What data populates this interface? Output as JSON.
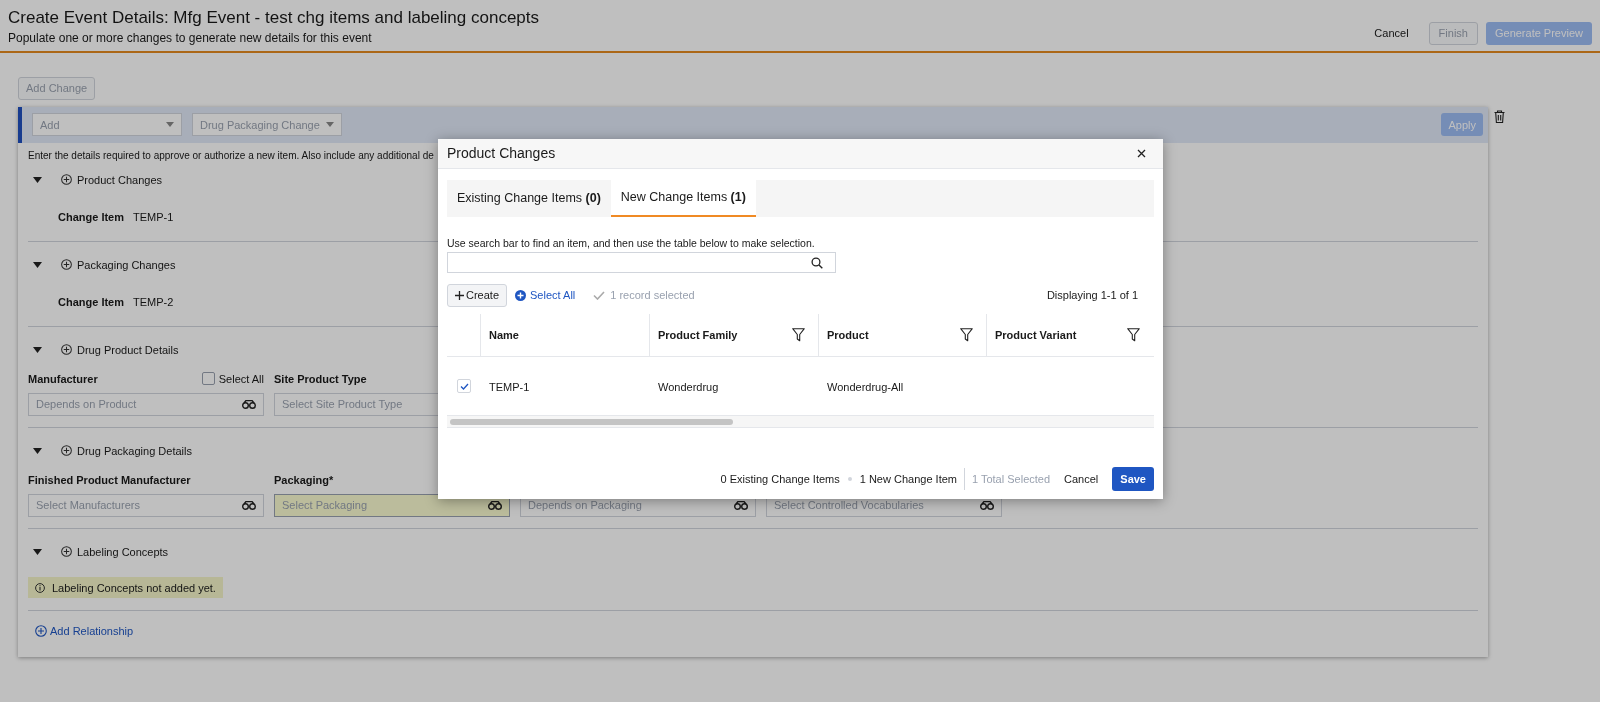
{
  "page": {
    "title": "Create Event Details: Mfg Event - test chg items and labeling concepts",
    "subtitle": "Populate one or more changes to generate new details for this event"
  },
  "header_actions": [
    {
      "label": "Cancel",
      "kind": "link",
      "disabled": false
    },
    {
      "label": "Finish",
      "kind": "outline",
      "disabled": true
    },
    {
      "label": "Generate Preview",
      "kind": "primary",
      "disabled": true
    }
  ],
  "add_change_button": {
    "label": "Add Change",
    "disabled": true
  },
  "change_panel": {
    "type_select": {
      "value": "Add"
    },
    "change_select": {
      "value": "Drug Packaging Change"
    },
    "apply_button": {
      "label": "Apply",
      "disabled": true
    },
    "description": "Enter the details required to approve or authorize a new item. Also include any additional de",
    "sections": [
      {
        "title": "Product Changes",
        "expanded": true,
        "kind": "items",
        "items": [
          {
            "label": "Change Item",
            "value": "TEMP-1"
          }
        ]
      },
      {
        "title": "Packaging Changes",
        "expanded": true,
        "kind": "items",
        "items": [
          {
            "label": "Change Item",
            "value": "TEMP-2"
          }
        ]
      },
      {
        "title": "Drug Product Details",
        "expanded": true,
        "kind": "fields",
        "fields": [
          {
            "label": "Manufacturer",
            "placeholder": "Depends on Product",
            "lookup": true,
            "highlighted": false,
            "select_all": {
              "label": "Select All",
              "checked": false
            }
          },
          {
            "label": "Site Product Type",
            "placeholder": "Select Site Product Type",
            "lookup": false,
            "highlighted": false
          }
        ]
      },
      {
        "title": "Drug Packaging Details",
        "expanded": true,
        "kind": "fields",
        "fields": [
          {
            "label": "Finished Product Manufacturer",
            "placeholder": "Select Manufacturers",
            "lookup": true,
            "highlighted": false
          },
          {
            "label": "Packaging*",
            "placeholder": "Select Packaging",
            "lookup": true,
            "highlighted": true
          },
          {
            "placeholder": "Depends on Packaging",
            "lookup": true,
            "highlighted": false
          },
          {
            "placeholder": "Select Controlled Vocabularies",
            "lookup": true,
            "highlighted": false
          }
        ]
      },
      {
        "title": "Labeling Concepts",
        "expanded": true,
        "kind": "notice",
        "notice": "Labeling Concepts not added yet."
      }
    ],
    "add_relationship": "Add Relationship"
  },
  "modal": {
    "title": "Product Changes",
    "tabs": [
      {
        "label": "Existing Change Items **(0)**",
        "selected": false
      },
      {
        "label": "New Change Items **(1)**",
        "selected": true
      }
    ],
    "instruction": "Use search bar to find an item, and then use the table below to make selection.",
    "create_button": "Create",
    "select_all": "Select All",
    "selection_status": "1 record selected",
    "displaying": "Displaying 1-1 of 1",
    "columns": [
      {
        "label": "Name",
        "filter": false
      },
      {
        "label": "Product Family",
        "filter": true
      },
      {
        "label": "Product",
        "filter": true
      },
      {
        "label": "Product Variant",
        "filter": true
      }
    ],
    "rows": [
      {
        "selected": true,
        "cells": [
          "TEMP-1",
          "Wonderdrug",
          "Wonderdrug-All"
        ]
      }
    ],
    "footer": {
      "existing": "0 Existing Change Items",
      "new": "1 New Change Item",
      "total": "1 Total Selected",
      "cancel": "Cancel",
      "save": "Save"
    }
  }
}
